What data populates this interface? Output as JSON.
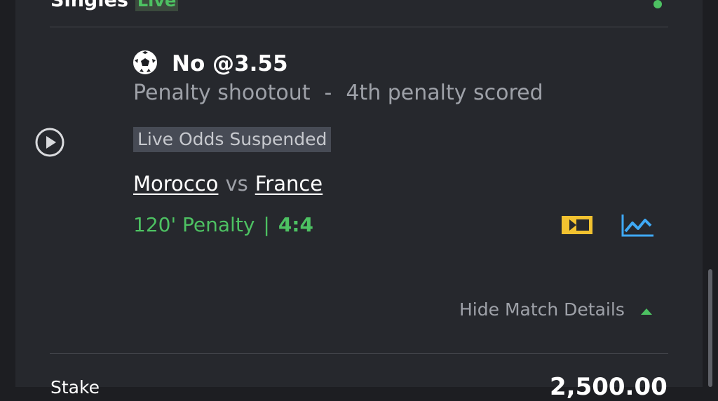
{
  "header": {
    "title": "Singles",
    "live_badge": "Live"
  },
  "bet": {
    "selection": "No @3.55",
    "market": "Penalty shootout",
    "separator": "-",
    "sub_market": "4th penalty scored",
    "status_badge": "Live Odds Suspended"
  },
  "match": {
    "home_team": "Morocco",
    "vs": "vs",
    "away_team": "France",
    "period": "120' Penalty",
    "separator": "|",
    "score": "4:4"
  },
  "actions": {
    "hide_details_label": "Hide Match Details"
  },
  "footer": {
    "stake_label": "Stake",
    "stake_value": "2,500.00"
  },
  "colors": {
    "live_green": "#4dc162",
    "tv_yellow": "#f2c230",
    "stats_blue": "#3fa9f5",
    "background": "#26282d"
  },
  "icons": [
    "share-icon",
    "soccer-ball-icon",
    "play-icon",
    "live-tv-icon",
    "stats-chart-icon",
    "caret-up-icon"
  ]
}
